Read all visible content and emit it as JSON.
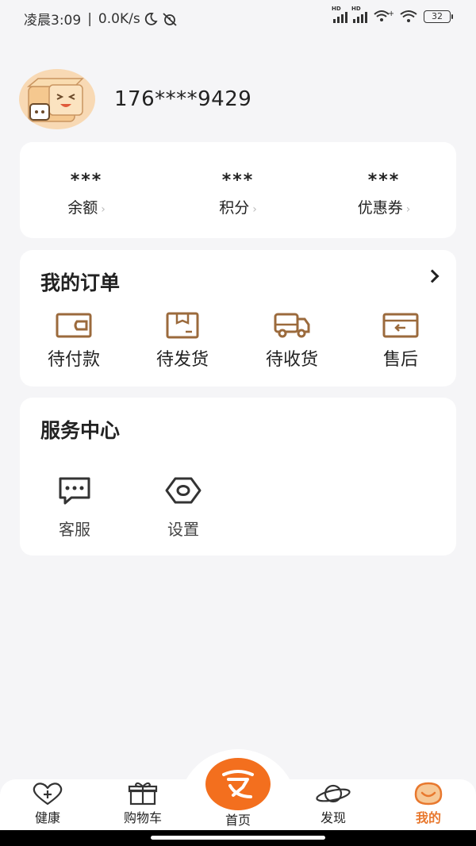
{
  "status_bar": {
    "time": "凌晨3:09",
    "net_speed": "0.0K/s",
    "battery": "32"
  },
  "profile": {
    "phone": "176****9429"
  },
  "assets": [
    {
      "value": "***",
      "label": "余额"
    },
    {
      "value": "***",
      "label": "积分"
    },
    {
      "value": "***",
      "label": "优惠券"
    }
  ],
  "orders": {
    "title": "我的订单",
    "items": [
      {
        "label": "待付款",
        "icon": "wallet-icon"
      },
      {
        "label": "待发货",
        "icon": "package-icon"
      },
      {
        "label": "待收货",
        "icon": "truck-icon"
      },
      {
        "label": "售后",
        "icon": "return-box-icon"
      }
    ]
  },
  "services": {
    "title": "服务中心",
    "items": [
      {
        "label": "客服",
        "icon": "chat-icon"
      },
      {
        "label": "设置",
        "icon": "hexagon-settings-icon"
      }
    ]
  },
  "tabbar": {
    "items": [
      {
        "label": "健康",
        "icon": "heart-plus-icon"
      },
      {
        "label": "购物车",
        "icon": "gift-box-icon"
      },
      {
        "label": "首页",
        "icon": "home-logo-icon"
      },
      {
        "label": "发现",
        "icon": "planet-icon"
      },
      {
        "label": "我的",
        "icon": "smile-face-icon",
        "active": true
      }
    ],
    "active_color": "#e8782e",
    "home_color": "#f36f1e"
  },
  "colors": {
    "icon_brown": "#9b6a3c",
    "background": "#f5f5f7"
  }
}
